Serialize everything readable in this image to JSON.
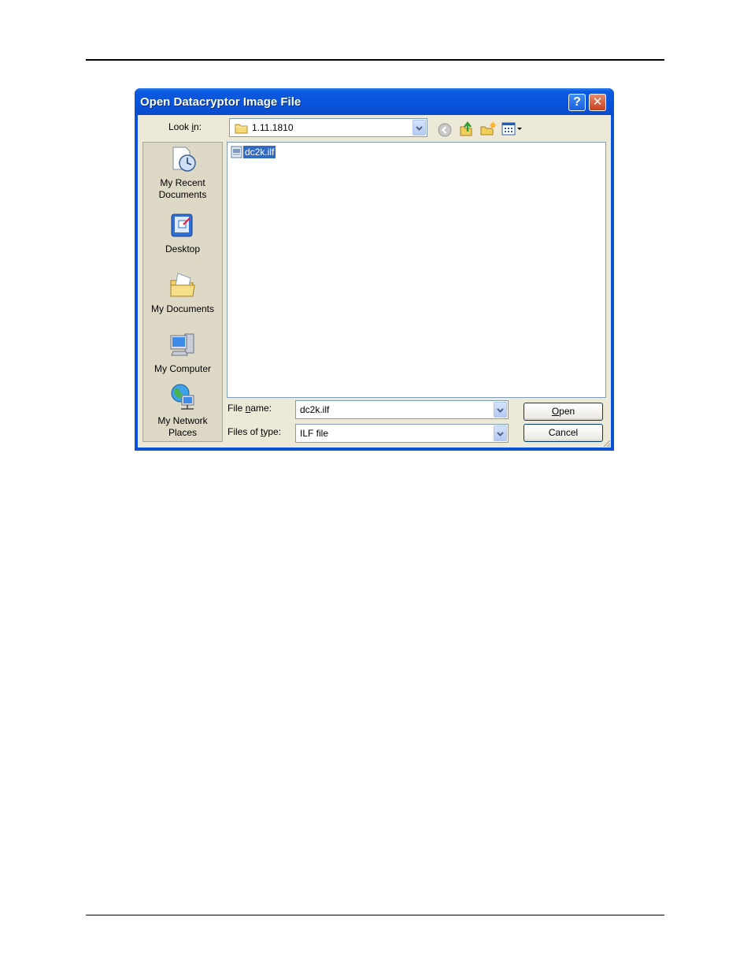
{
  "dialog": {
    "title": "Open Datacryptor Image File",
    "help_label": "?",
    "close_label": "✕"
  },
  "look_in": {
    "label_pre": "Look ",
    "label_accel": "i",
    "label_post": "n:",
    "value": "1.11.1810"
  },
  "toolbar": {
    "icons": [
      "back-icon",
      "up-folder-icon",
      "new-folder-icon",
      "views-menu-icon"
    ]
  },
  "places": [
    {
      "line1": "My Recent",
      "line2": "Documents",
      "icon": "recent-documents-icon"
    },
    {
      "line1": "Desktop",
      "line2": "",
      "icon": "desktop-icon"
    },
    {
      "line1": "My Documents",
      "line2": "",
      "icon": "my-documents-icon"
    },
    {
      "line1": "My Computer",
      "line2": "",
      "icon": "my-computer-icon"
    },
    {
      "line1": "My Network",
      "line2": "Places",
      "icon": "network-places-icon"
    }
  ],
  "files": [
    {
      "name": "dc2k.ilf",
      "selected": true
    }
  ],
  "file_name": {
    "label_pre": "File ",
    "label_accel": "n",
    "label_post": "ame:",
    "value": "dc2k.ilf"
  },
  "file_type": {
    "label_pre": "Files of ",
    "label_accel": "t",
    "label_post": "ype:",
    "value": "ILF file"
  },
  "buttons": {
    "open_accel": "O",
    "open_rest": "pen",
    "cancel": "Cancel"
  },
  "colors": {
    "titlebar": "#0854dc",
    "dialog_face": "#ece9d8",
    "selection": "#316ac5"
  }
}
